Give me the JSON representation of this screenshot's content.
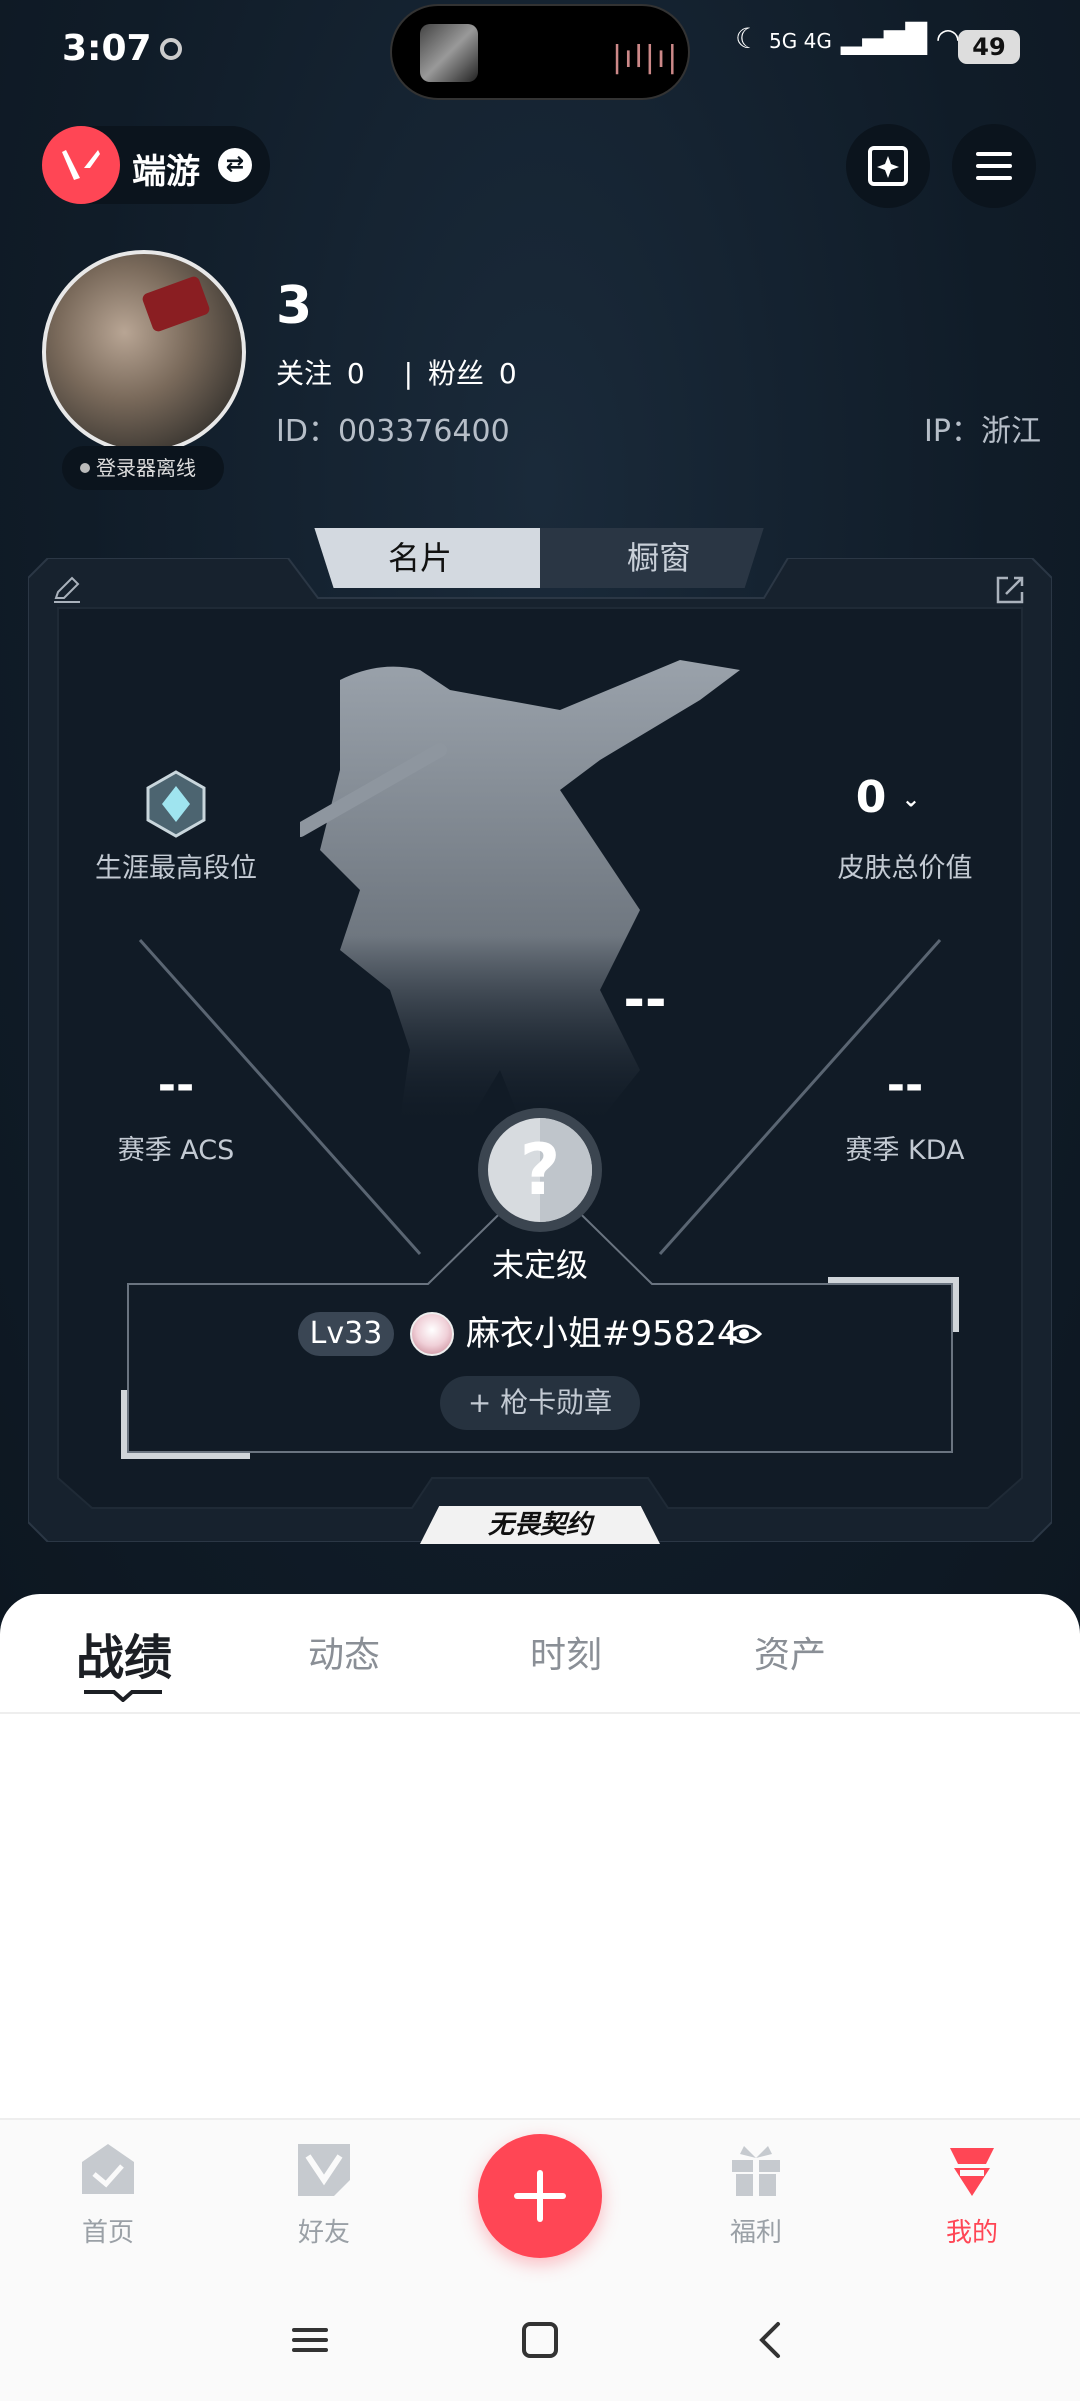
{
  "status_bar": {
    "time": "3:07",
    "signal_text": "5G 4G",
    "battery": "49"
  },
  "header": {
    "app_name": "端游"
  },
  "profile": {
    "nickname": "3",
    "follow_label": "关注",
    "follow_count": "0",
    "fans_label": "粉丝",
    "fans_count": "0",
    "id": "ID：003376400",
    "ip": "IP：浙江",
    "online_status": "登录器离线"
  },
  "card": {
    "tabs": [
      "名片",
      "橱窗"
    ],
    "active_tab": "名片",
    "career_rank_label": "生涯最高段位",
    "skin_value": "0",
    "skin_label": "皮肤总价值",
    "center_value": "--",
    "acs_value": "--",
    "acs_label": "赛季 ACS",
    "kda_value": "--",
    "kda_label": "赛季 KDA",
    "rank_label": "未定级",
    "level": "Lv33",
    "riot_id": "麻衣小姐#95824",
    "medal_button": "+ 枪卡勋章",
    "brand": "无畏契约"
  },
  "content_tabs": [
    "战绩",
    "动态",
    "时刻",
    "资产"
  ],
  "active_content_tab": "战绩",
  "bottom_nav": {
    "home": "首页",
    "friends": "好友",
    "welfare": "福利",
    "me": "我的"
  },
  "colors": {
    "accent": "#ff4655",
    "bg_dark": "#0f1a26",
    "panel": "#ffffff"
  }
}
